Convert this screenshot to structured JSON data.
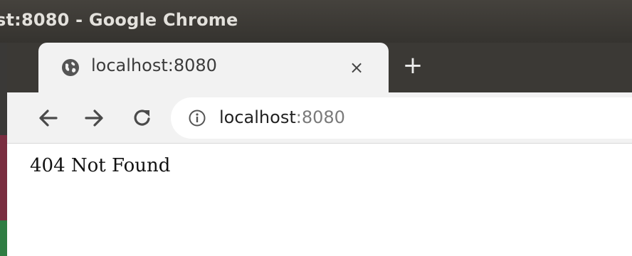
{
  "window": {
    "title": "st:8080 - Google Chrome"
  },
  "tab": {
    "title": "localhost:8080",
    "close_symbol": "×",
    "favicon": "globe-icon"
  },
  "new_tab": {
    "symbol": "+"
  },
  "toolbar": {
    "back_icon": "arrow-left-icon",
    "forward_icon": "arrow-right-icon",
    "reload_icon": "reload-icon"
  },
  "omnibox": {
    "info_icon": "info-icon",
    "url_host": "localhost",
    "url_port": ":8080"
  },
  "page": {
    "text": "404 Not Found"
  },
  "colors": {
    "titlebar": "#3b3935",
    "tab_active": "#f2f2f2",
    "page_bg": "#ffffff"
  }
}
